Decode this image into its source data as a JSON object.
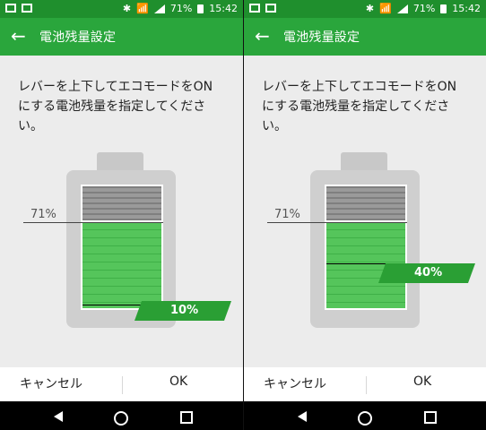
{
  "screens": [
    {
      "status_time": "15:42",
      "battery_percent": "71%",
      "appbar_title": "電池残量設定",
      "instruction": "レバーを上下してエコモードをONにする電池残量を指定してください。",
      "current_battery_label": "71%",
      "threshold_label": "10%",
      "threshold_value": 10,
      "cancel_label": "キャンセル",
      "ok_label": "OK"
    },
    {
      "status_time": "15:42",
      "battery_percent": "71%",
      "appbar_title": "電池残量設定",
      "instruction": "レバーを上下してエコモードをONにする電池残量を指定してください。",
      "current_battery_label": "71%",
      "threshold_label": "40%",
      "threshold_value": 40,
      "cancel_label": "キャンセル",
      "ok_label": "OK"
    }
  ],
  "icons": {
    "back": "arrow-left-icon",
    "nav_back": "triangle-back-icon",
    "nav_home": "circle-home-icon",
    "nav_recent": "square-recents-icon"
  }
}
